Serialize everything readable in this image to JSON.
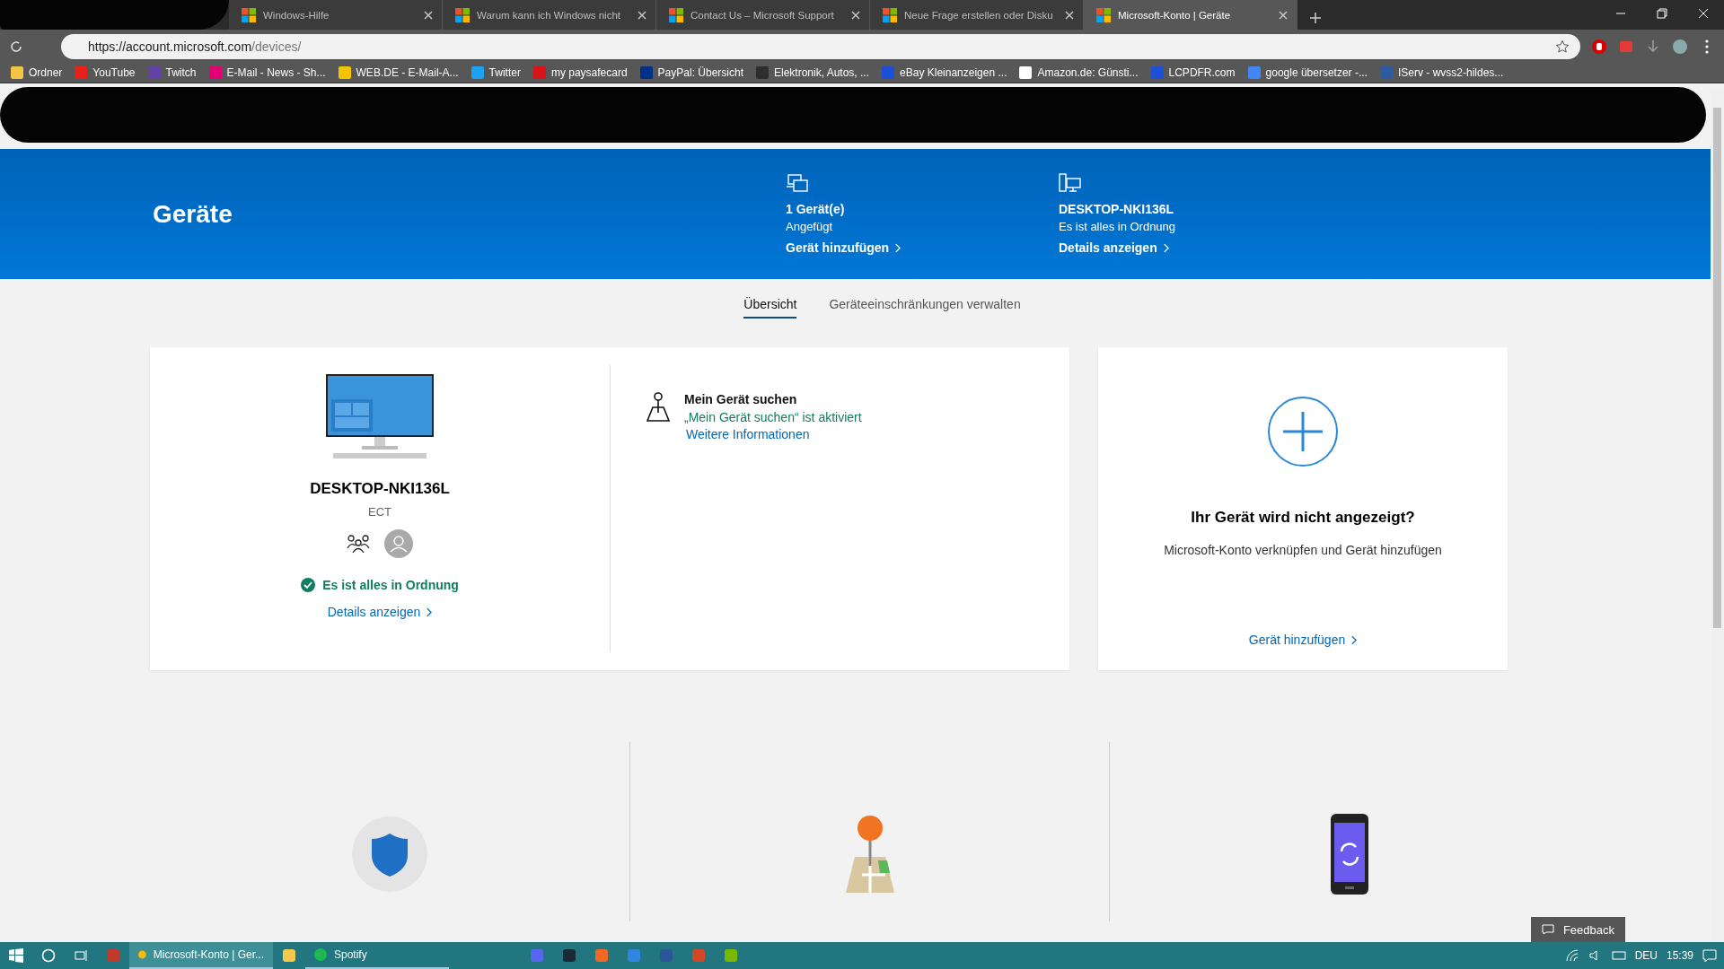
{
  "browser": {
    "tabs": [
      {
        "title": "Windows-Hilfe",
        "selected": false
      },
      {
        "title": "Warum kann ich Windows nicht",
        "selected": false
      },
      {
        "title": "Contact Us – Microsoft Support",
        "selected": false
      },
      {
        "title": "Neue Frage erstellen oder Disku",
        "selected": false
      },
      {
        "title": "Microsoft-Konto | Geräte",
        "selected": true
      }
    ],
    "url": {
      "host": "https://account.microsoft.com",
      "path": "/devices/"
    },
    "bookmarks": [
      {
        "label": "Ordner",
        "color": "#f4c542"
      },
      {
        "label": "YouTube",
        "color": "#e62117"
      },
      {
        "label": "Twitch",
        "color": "#6441a4"
      },
      {
        "label": "E-Mail - News - Sh...",
        "color": "#e20074"
      },
      {
        "label": "WEB.DE - E-Mail-A...",
        "color": "#f5c400"
      },
      {
        "label": "Twitter",
        "color": "#1da1f2"
      },
      {
        "label": "my paysafecard",
        "color": "#d7141a"
      },
      {
        "label": "PayPal: Übersicht",
        "color": "#003087"
      },
      {
        "label": "Elektronik, Autos, ...",
        "color": "#2f2f2f"
      },
      {
        "label": "eBay Kleinanzeigen ...",
        "color": "#1d4ed8"
      },
      {
        "label": "Amazon.de: Günsti...",
        "color": "#ffffff"
      },
      {
        "label": "LCPDFR.com",
        "color": "#1e4fd8"
      },
      {
        "label": "google übersetzer -...",
        "color": "#4285f4"
      },
      {
        "label": "IServ - wvss2-hildes...",
        "color": "#2d5aa0"
      }
    ]
  },
  "header": {
    "title": "Geräte",
    "summary": [
      {
        "kind": "devices",
        "title": "1 Gerät(e)",
        "subtitle": "Angefügt",
        "link": "Gerät hinzufügen"
      },
      {
        "kind": "desktop",
        "title": "DESKTOP-NKI136L",
        "subtitle": "Es ist alles in Ordnung",
        "link": "Details anzeigen"
      }
    ]
  },
  "nav_tabs": [
    {
      "label": "Übersicht",
      "selected": true
    },
    {
      "label": "Geräteeinschränkungen verwalten",
      "selected": false
    }
  ],
  "device_card": {
    "name": "DESKTOP-NKI136L",
    "type": "ECT",
    "status": "Es ist alles in Ordnung",
    "link": "Details anzeigen",
    "find_device": {
      "title": "Mein Gerät suchen",
      "status": "„Mein Gerät suchen“ ist aktiviert",
      "link": "Weitere Informationen"
    }
  },
  "add_card": {
    "title": "Ihr Gerät wird nicht angezeigt?",
    "text": "Microsoft-Konto verknüpfen und Gerät hinzufügen",
    "link": "Gerät hinzufügen"
  },
  "feedback": "Feedback",
  "taskbar": {
    "apps": [
      {
        "label": "Microsoft-Konto | Ger...",
        "selected": true
      },
      {
        "label": "Spotify",
        "selected": false
      }
    ],
    "language": "DEU",
    "time": "15:39"
  }
}
